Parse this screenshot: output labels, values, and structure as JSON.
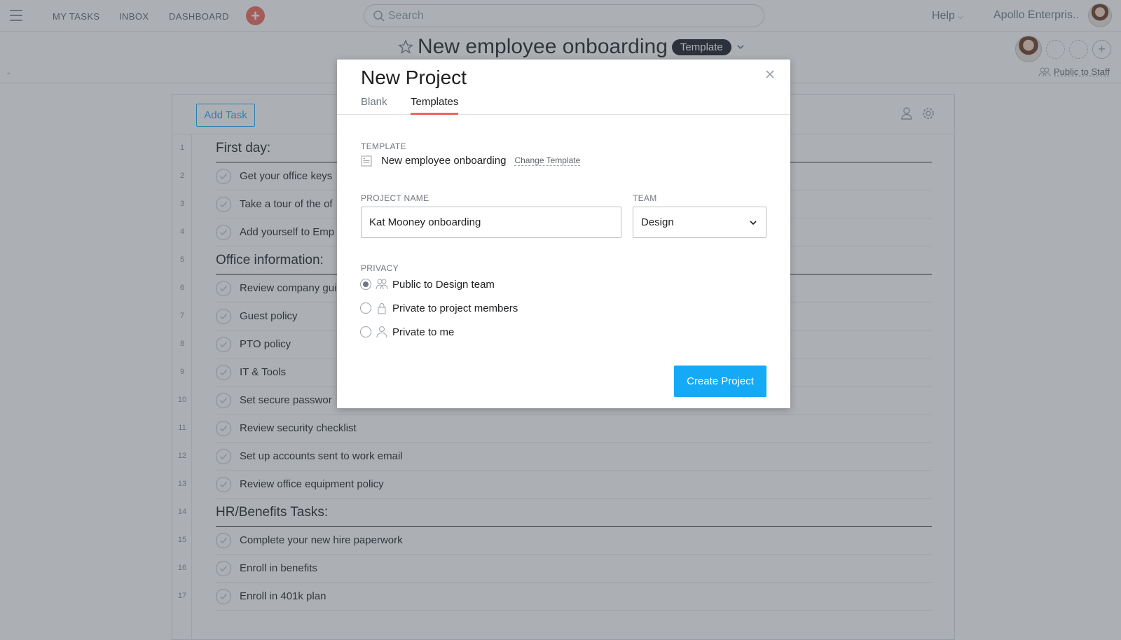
{
  "topbar": {
    "nav": [
      "MY TASKS",
      "INBOX",
      "DASHBOARD"
    ],
    "quick_add": "+",
    "search_placeholder": "Search",
    "help": "Help",
    "org": "Apollo Enterpris..."
  },
  "project": {
    "title": "New employee onboarding",
    "badge": "Template",
    "privacy": "Public to Staff"
  },
  "panel": {
    "add_task": "Add Task",
    "rows": [
      {
        "n": "1",
        "text": "First day:",
        "section": true
      },
      {
        "n": "2",
        "text": "Get your office keys",
        "section": false
      },
      {
        "n": "3",
        "text": "Take a tour of the of",
        "section": false
      },
      {
        "n": "4",
        "text": "Add yourself to Emp",
        "section": false
      },
      {
        "n": "5",
        "text": "Office information:",
        "section": true
      },
      {
        "n": "6",
        "text": "Review company gui",
        "section": false
      },
      {
        "n": "7",
        "text": "Guest policy",
        "section": false
      },
      {
        "n": "8",
        "text": "PTO policy",
        "section": false
      },
      {
        "n": "9",
        "text": "IT & Tools",
        "section": false
      },
      {
        "n": "10",
        "text": "Set secure passwor",
        "section": false
      },
      {
        "n": "11",
        "text": "Review security checklist",
        "section": false
      },
      {
        "n": "12",
        "text": "Set up accounts sent to work email",
        "section": false
      },
      {
        "n": "13",
        "text": "Review office equipment policy",
        "section": false
      },
      {
        "n": "14",
        "text": "HR/Benefits Tasks:",
        "section": true
      },
      {
        "n": "15",
        "text": "Complete your new hire paperwork",
        "section": false
      },
      {
        "n": "16",
        "text": "Enroll in benefits",
        "section": false
      },
      {
        "n": "17",
        "text": "Enroll in 401k plan",
        "section": false
      }
    ]
  },
  "modal": {
    "title": "New Project",
    "tabs": [
      "Blank",
      "Templates"
    ],
    "active_tab": "Templates",
    "template_label": "TEMPLATE",
    "template_name": "New employee onboarding",
    "change_template": "Change Template",
    "project_name_label": "PROJECT NAME",
    "project_name_value": "Kat Mooney onboarding",
    "team_label": "TEAM",
    "team_value": "Design",
    "privacy_label": "PRIVACY",
    "privacy_options": [
      {
        "label": "Public to Design team",
        "icon": "team-icon",
        "checked": true
      },
      {
        "label": "Private to project members",
        "icon": "lock-icon",
        "checked": false
      },
      {
        "label": "Private to me",
        "icon": "person-icon",
        "checked": false
      }
    ],
    "create_button": "Create Project"
  }
}
